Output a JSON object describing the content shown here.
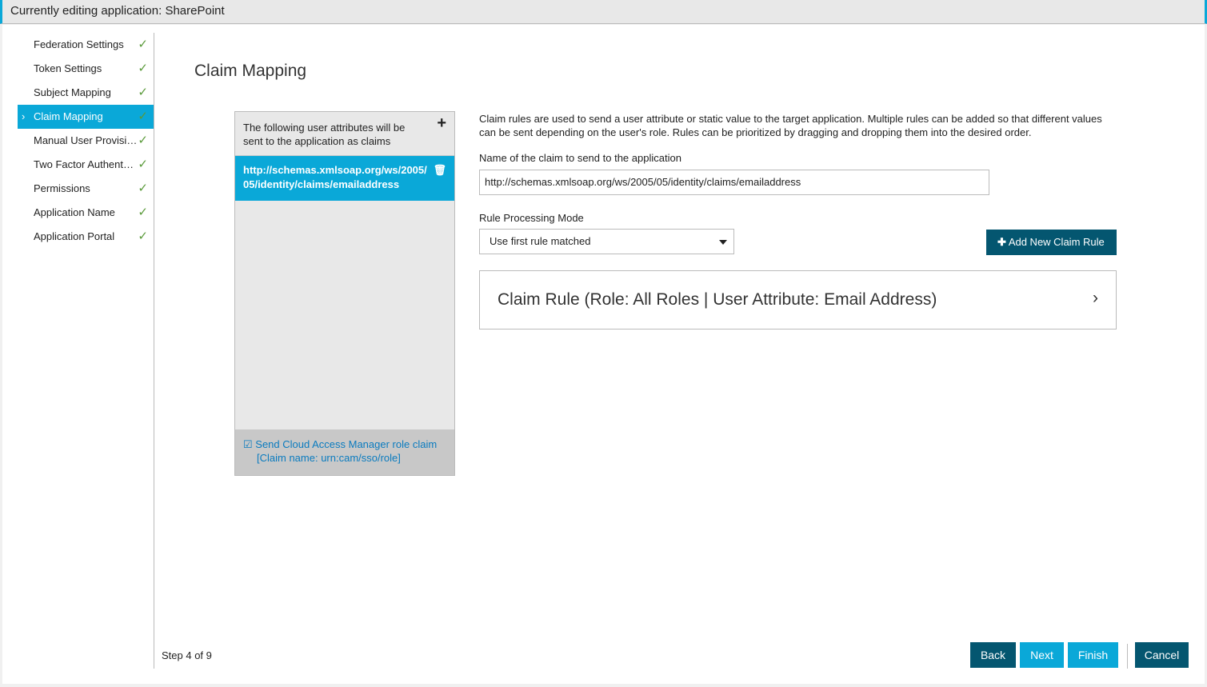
{
  "header": {
    "title": "Currently editing application: SharePoint"
  },
  "nav": {
    "items": [
      {
        "label": "Federation Settings"
      },
      {
        "label": "Token Settings"
      },
      {
        "label": "Subject Mapping"
      },
      {
        "label": "Claim Mapping"
      },
      {
        "label": "Manual User Provisi…"
      },
      {
        "label": "Two Factor Authent…"
      },
      {
        "label": "Permissions"
      },
      {
        "label": "Application Name"
      },
      {
        "label": "Application Portal"
      }
    ],
    "check": "✓",
    "active_index": 3
  },
  "page": {
    "title": "Claim Mapping"
  },
  "claims_panel": {
    "header": "The following user attributes will be sent to the application as claims",
    "items": [
      "http://schemas.xmlsoap.org/ws/2005/05/identity/claims/emailaddress"
    ],
    "footer_line1": "Send Cloud Access Manager role claim",
    "footer_line2": "[Claim name: urn:cam/sso/role]",
    "footer_checked": true
  },
  "detail": {
    "description": "Claim rules are used to send a user attribute or static value to the target application. Multiple rules can be added so that different values can be sent depending on the user's role. Rules can be prioritized by dragging and dropping them into the desired order.",
    "claim_name_label": "Name of the claim to send to the application",
    "claim_name_value": "http://schemas.xmlsoap.org/ws/2005/05/identity/claims/emailaddress",
    "mode_label": "Rule Processing Mode",
    "mode_value": "Use first rule matched",
    "add_rule": "Add New Claim Rule",
    "rules": [
      "Claim Rule (Role: All Roles | User Attribute: Email Address)"
    ]
  },
  "footer": {
    "step": "Step 4 of 9",
    "back": "Back",
    "next": "Next",
    "finish": "Finish",
    "cancel": "Cancel"
  }
}
